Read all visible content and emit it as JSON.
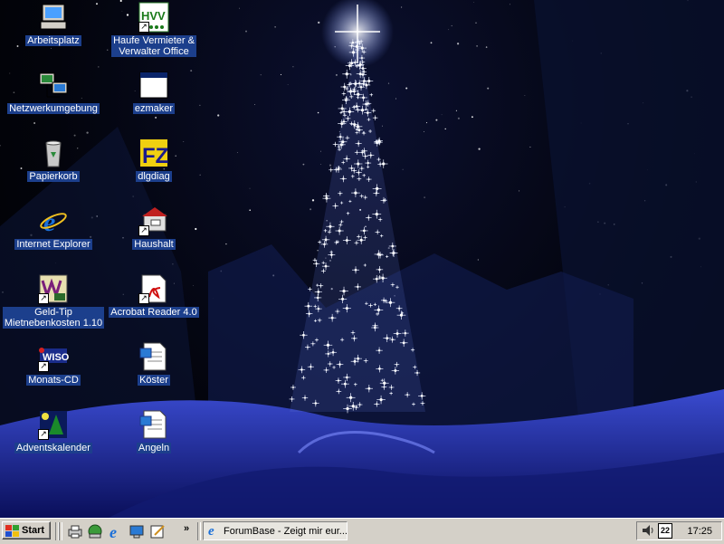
{
  "desktop": {
    "icons": [
      {
        "label": "Arbeitsplatz",
        "icon": "my-computer-icon",
        "shortcut": false
      },
      {
        "label": "Haufe Vermieter &\nVerwalter Office",
        "icon": "haufe-office-icon",
        "shortcut": true
      },
      {
        "label": "Netzwerkumgebung",
        "icon": "network-neighborhood-icon",
        "shortcut": false
      },
      {
        "label": "ezmaker",
        "icon": "window-app-icon",
        "shortcut": false
      },
      {
        "label": "Papierkorb",
        "icon": "recycle-bin-icon",
        "shortcut": false
      },
      {
        "label": "dlgdiag",
        "icon": "filezilla-icon",
        "shortcut": false
      },
      {
        "label": "Internet Explorer",
        "icon": "internet-explorer-icon",
        "shortcut": false
      },
      {
        "label": "Haushalt",
        "icon": "household-app-icon",
        "shortcut": true
      },
      {
        "label": "Geld-Tip\nMietnebenkosten 1.10",
        "icon": "geld-tip-icon",
        "shortcut": true
      },
      {
        "label": "Acrobat Reader 4.0",
        "icon": "acrobat-reader-icon",
        "shortcut": true
      },
      {
        "label": "Monats-CD",
        "icon": "wiso-icon",
        "shortcut": true
      },
      {
        "label": "Köster",
        "icon": "document-icon",
        "shortcut": false
      },
      {
        "label": "Adventskalender",
        "icon": "advent-calendar-icon",
        "shortcut": true
      },
      {
        "label": "Angeln",
        "icon": "document-icon",
        "shortcut": false
      }
    ]
  },
  "taskbar": {
    "start_label": "Start",
    "chevron": "»",
    "task_button_label": "ForumBase - Zeigt mir eur...",
    "tray_date_badge": "22",
    "clock": "17:25"
  },
  "colors": {
    "taskbar": "#d4d0c8",
    "label_highlight": "#1c3f8c"
  }
}
